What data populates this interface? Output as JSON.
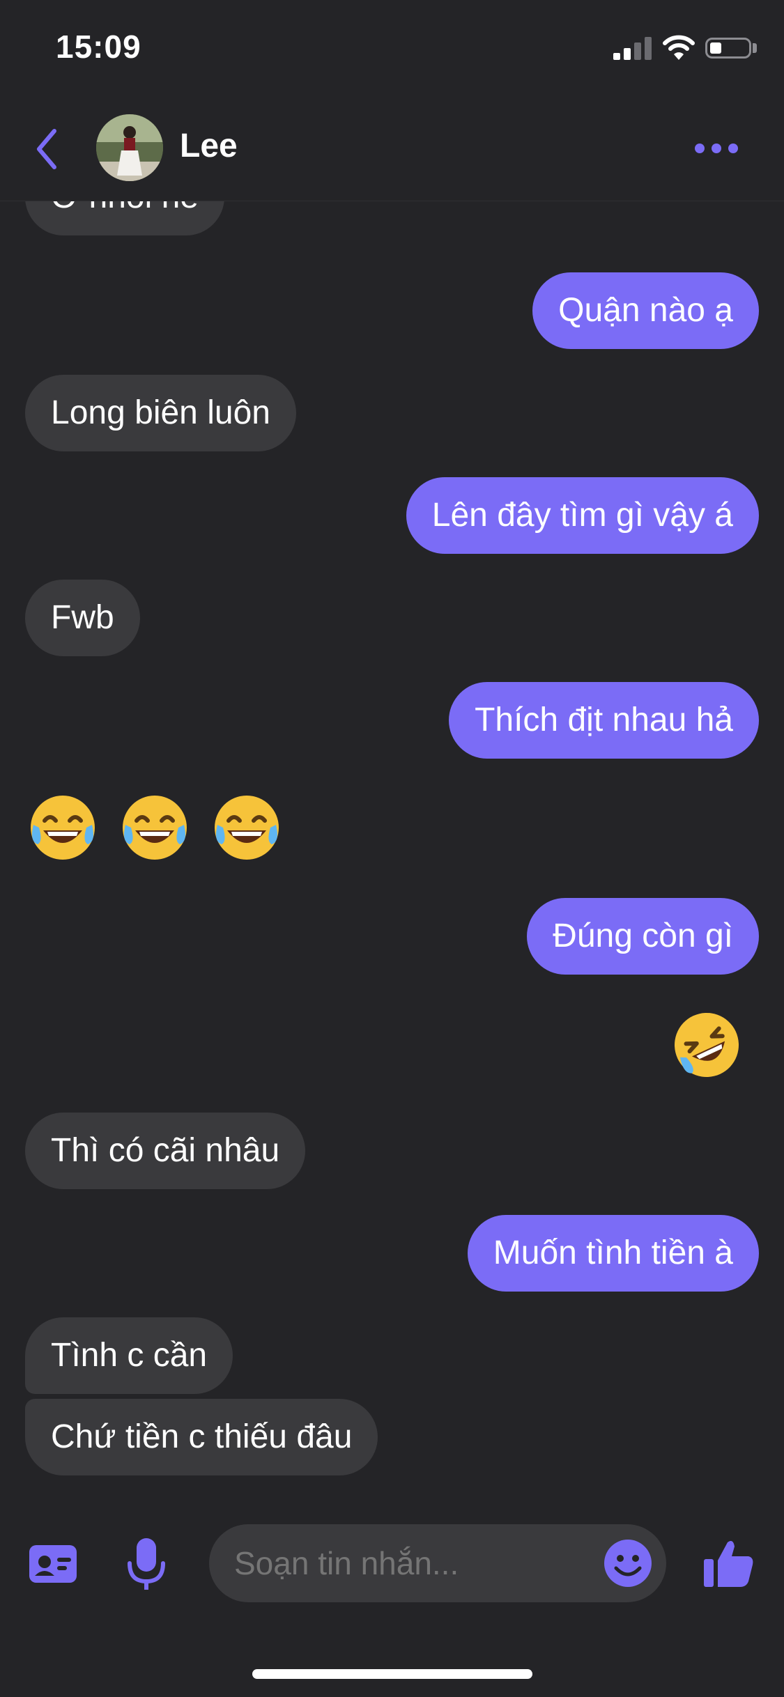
{
  "status_bar": {
    "time": "15:09"
  },
  "header": {
    "contact_name": "Lee"
  },
  "messages": [
    {
      "side": "in",
      "text": "Ơ nhồi nè"
    },
    {
      "side": "out",
      "text": "Quận nào ạ"
    },
    {
      "side": "in",
      "text": "Long biên luôn"
    },
    {
      "side": "out",
      "text": "Lên đây tìm gì vậy á"
    },
    {
      "side": "in",
      "text": "Fwb"
    },
    {
      "side": "out",
      "text": "Thích địt nhau hả"
    },
    {
      "side": "in",
      "emoji": [
        "face-with-tears-of-joy",
        "face-with-tears-of-joy",
        "face-with-tears-of-joy"
      ]
    },
    {
      "side": "out",
      "text": "Đúng còn gì"
    },
    {
      "side": "out",
      "emoji": [
        "rolling-on-the-floor-laughing"
      ]
    },
    {
      "side": "in",
      "text": "Thì có cãi nhâu"
    },
    {
      "side": "out",
      "text": "Muốn tình tiền à"
    },
    {
      "side": "in",
      "text": "Tình c cần"
    },
    {
      "side": "in",
      "text": "Chứ tiền c thiếu đâu"
    }
  ],
  "composer": {
    "placeholder": "Soạn tin nhắn..."
  },
  "colors": {
    "accent": "#7b6cf6",
    "background": "#242427",
    "incoming_bubble": "#3a3a3d"
  },
  "icons": [
    "back-chevron-icon",
    "more-options-icon",
    "contact-card-icon",
    "microphone-icon",
    "emoji-smiley-icon",
    "thumbs-up-icon"
  ]
}
